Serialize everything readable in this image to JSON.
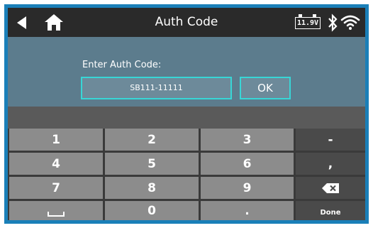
{
  "topbar": {
    "title": "Auth Code",
    "battery_voltage": "11.9V",
    "icons": [
      "back-arrow-icon",
      "home-icon",
      "battery-icon",
      "bluetooth-icon",
      "wifi-icon"
    ]
  },
  "auth": {
    "prompt": "Enter Auth Code:",
    "value": "SB111-11111",
    "ok_label": "OK"
  },
  "keyboard": {
    "rows": [
      [
        "1",
        "2",
        "3",
        "-"
      ],
      [
        "4",
        "5",
        "6",
        ","
      ],
      [
        "7",
        "8",
        "9",
        ""
      ],
      [
        "",
        "0",
        ".",
        "Done"
      ]
    ],
    "special_icons": [
      "backspace-icon",
      "space-icon"
    ]
  },
  "colors": {
    "frame": "#1a7fb8",
    "topbar": "#2a2a2a",
    "content": "#5c7c8d",
    "field_border": "#38d6d6",
    "key_light": "#8c8c8c",
    "key_dark": "#4a4a4a"
  }
}
